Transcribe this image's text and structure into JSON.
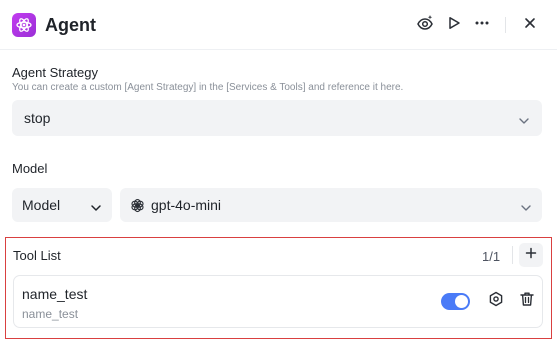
{
  "header": {
    "title": "Agent",
    "icons": {
      "app": "agent-atom-icon",
      "preview": "eye-sparkle-icon",
      "run": "play-icon",
      "more": "more-horizontal-icon",
      "close": "close-icon"
    }
  },
  "strategy": {
    "label": "Agent Strategy",
    "description": "You can create a custom [Agent Strategy] in the [Services & Tools] and reference it here.",
    "value": "stop"
  },
  "model": {
    "label": "Model",
    "type_value": "Model",
    "model_value": "gpt-4o-mini",
    "model_icon": "openai-icon"
  },
  "tools": {
    "label": "Tool List",
    "count": "1/1",
    "items": [
      {
        "name": "name_test",
        "description": "name_test",
        "enabled": true
      }
    ]
  },
  "colors": {
    "brand": "#b536e8",
    "toggle_on": "#4a7bf7",
    "highlight_border": "#d94040"
  }
}
